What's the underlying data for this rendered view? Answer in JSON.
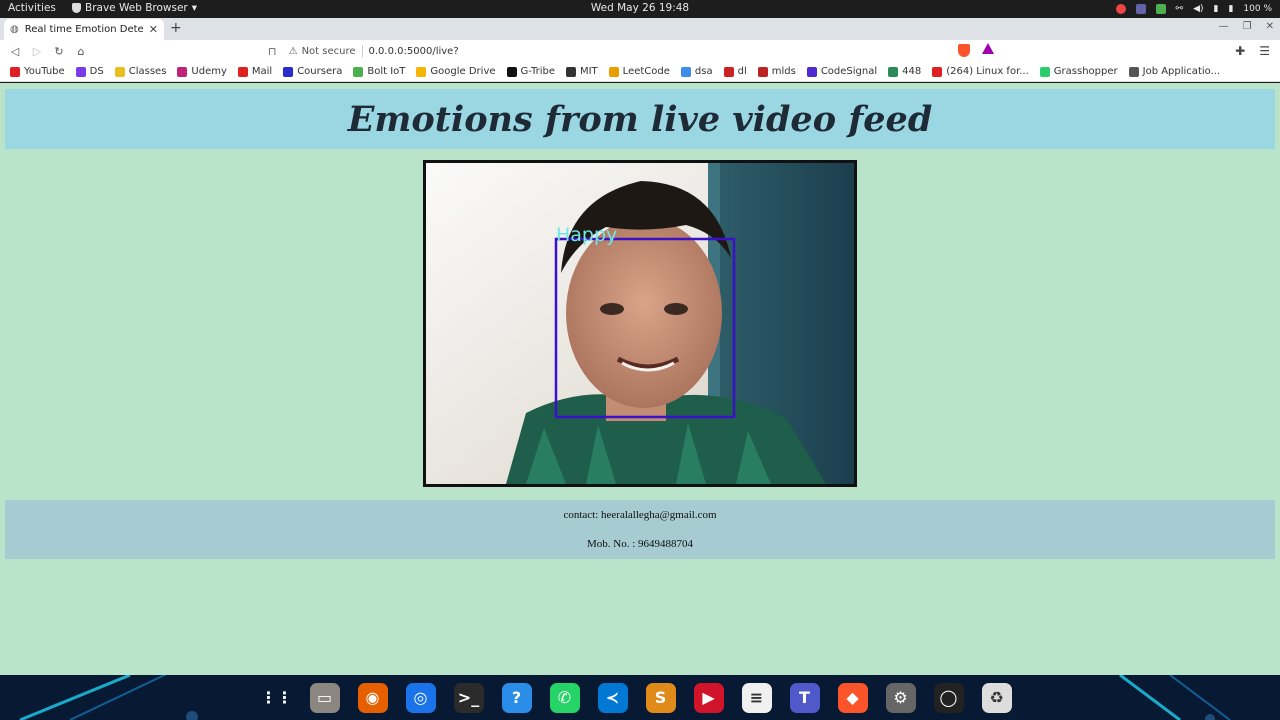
{
  "system": {
    "activities": "Activities",
    "app_name": "Brave Web Browser",
    "clock": "Wed May 26  19:48",
    "battery": "100 %"
  },
  "browser": {
    "tab_title": "Real time Emotion Detect",
    "url_security": "Not secure",
    "url": "0.0.0.0:5000/live?",
    "bookmarks": [
      "YouTube",
      "DS",
      "Classes",
      "Udemy",
      "Mail",
      "Coursera",
      "Bolt IoT",
      "Google Drive",
      "G-Tribe",
      "MIT",
      "LeetCode",
      "dsa",
      "dl",
      "mlds",
      "CodeSignal",
      "448",
      "(264) Linux for...",
      "Grasshopper",
      "Job Applicatio..."
    ],
    "bookmark_colors": [
      "#e02020",
      "#7a3ce8",
      "#e8c020",
      "#c0247a",
      "#d22",
      "#2b2bd0",
      "#4caf50",
      "#f4b400",
      "#111",
      "#333",
      "#e8a000",
      "#3c8ce8",
      "#c22",
      "#b22",
      "#4b2bd0",
      "#2e8b57",
      "#e02020",
      "#2ecc71",
      "#555"
    ]
  },
  "page": {
    "heading": "Emotions from live video feed",
    "emotion_label": "Happy",
    "contact": "contact: heeralallegha@gmail.com",
    "mobile": "Mob. No. : 9649488704"
  },
  "dock": {
    "icons": [
      "app-grid-icon",
      "files-icon",
      "firefox-icon",
      "chrome-icon",
      "terminal-icon",
      "help-icon",
      "whatsapp-icon",
      "vscode-icon",
      "sublime-text-icon",
      "youtube-music-icon",
      "text-editor-icon",
      "teams-icon",
      "brave-icon",
      "settings-icon",
      "obs-icon",
      "trash-icon"
    ],
    "colors": [
      "#444",
      "#8b8680",
      "#e66000",
      "#1a73e8",
      "#2b2b2b",
      "#2a8de8",
      "#25d366",
      "#0078d4",
      "#e08a1a",
      "#d0152a",
      "#f0f0f0",
      "#5059c9",
      "#fb542b",
      "#666",
      "#222",
      "#ddd"
    ]
  }
}
